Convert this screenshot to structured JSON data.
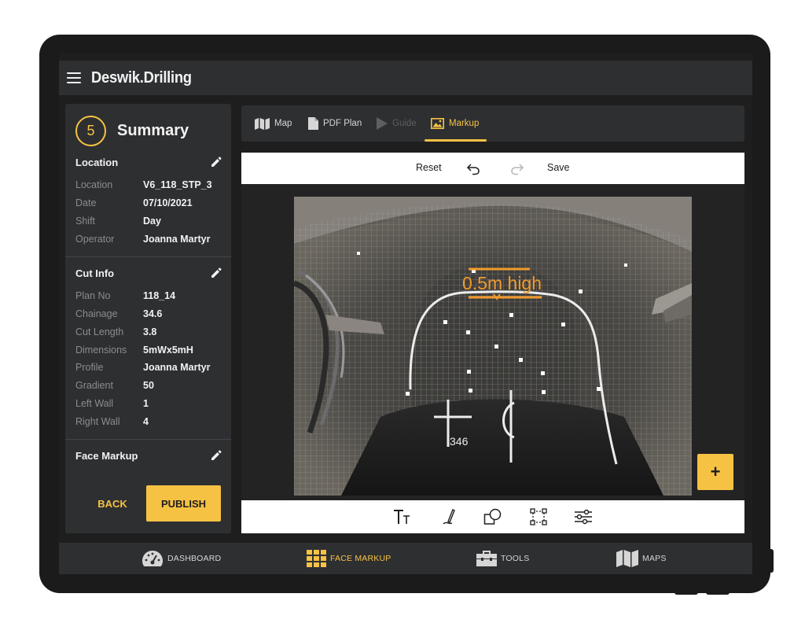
{
  "app": {
    "title": "Deswik.Drilling"
  },
  "summary": {
    "step": "5",
    "title": "Summary",
    "location_section": {
      "heading": "Location",
      "rows": [
        {
          "key": "Location",
          "value": "V6_118_STP_3"
        },
        {
          "key": "Date",
          "value": "07/10/2021"
        },
        {
          "key": "Shift",
          "value": "Day"
        },
        {
          "key": "Operator",
          "value": "Joanna Martyr"
        }
      ]
    },
    "cut_section": {
      "heading": "Cut Info",
      "rows": [
        {
          "key": "Plan No",
          "value": "118_14"
        },
        {
          "key": "Chainage",
          "value": "34.6"
        },
        {
          "key": "Cut Length",
          "value": "3.8"
        },
        {
          "key": "Dimensions",
          "value": "5mWx5mH"
        },
        {
          "key": "Profile",
          "value": "Joanna Martyr"
        },
        {
          "key": "Gradient",
          "value": "50"
        },
        {
          "key": "Left Wall",
          "value": "1"
        },
        {
          "key": "Right Wall",
          "value": "4"
        }
      ]
    },
    "face_section": {
      "heading": "Face Markup"
    },
    "back_label": "BACK",
    "publish_label": "PUBLISH"
  },
  "tabs": [
    {
      "label": "Map",
      "icon": "map-icon",
      "state": "normal"
    },
    {
      "label": "PDF Plan",
      "icon": "document-icon",
      "state": "normal"
    },
    {
      "label": "Guide",
      "icon": "play-icon",
      "state": "disabled"
    },
    {
      "label": "Markup",
      "icon": "image-icon",
      "state": "active"
    }
  ],
  "toolbar": {
    "reset_label": "Reset",
    "save_label": "Save"
  },
  "photo": {
    "annotation_text": "0.5m high",
    "chalk_number": "346"
  },
  "fab": {
    "label": "+"
  },
  "draw_tools": [
    "text-tool-icon",
    "pen-tool-icon",
    "shape-tool-icon",
    "select-tool-icon",
    "adjust-tool-icon"
  ],
  "bottom_nav": [
    {
      "label": "DASHBOARD",
      "icon": "speedometer-icon",
      "active": false
    },
    {
      "label": "FACE MARKUP",
      "icon": "grid-icon",
      "active": true
    },
    {
      "label": "TOOLS",
      "icon": "toolbox-icon",
      "active": false
    },
    {
      "label": "MAPS",
      "icon": "map-icon",
      "active": false
    }
  ],
  "colors": {
    "accent": "#f6c244",
    "panel": "#2e2f31",
    "background": "#1e1e1e"
  }
}
